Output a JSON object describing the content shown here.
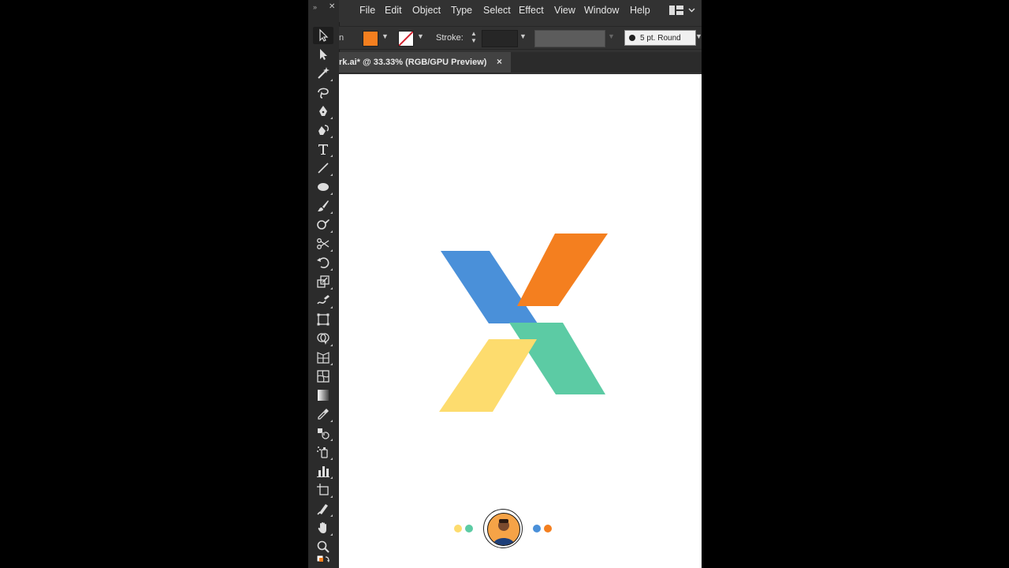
{
  "menu": {
    "items": [
      "File",
      "Edit",
      "Object",
      "Type",
      "Select",
      "Effect",
      "View",
      "Window",
      "Help"
    ]
  },
  "control_bar": {
    "leading_text": "n",
    "fill_color": "#f47f1f",
    "stroke_label": "Stroke:",
    "stroke_value": "",
    "brush_label": "5 pt. Round"
  },
  "document": {
    "tab_title": "rk.ai* @ 33.33% (RGB/GPU Preview)",
    "close_glyph": "×"
  },
  "tools": [
    "selection-tool-icon",
    "direct-selection-tool-icon",
    "magic-wand-tool-icon",
    "lasso-tool-icon",
    "pen-tool-icon",
    "curvature-tool-icon",
    "type-tool-icon",
    "line-segment-tool-icon",
    "ellipse-tool-icon",
    "paintbrush-tool-icon",
    "shaper-tool-icon",
    "scissors-tool-icon",
    "rotate-tool-icon",
    "scale-tool-icon",
    "warp-tool-icon",
    "free-transform-tool-icon",
    "shape-builder-tool-icon",
    "perspective-grid-tool-icon",
    "mesh-tool-icon",
    "gradient-tool-icon",
    "eyedropper-tool-icon",
    "blend-tool-icon",
    "symbol-sprayer-tool-icon",
    "column-graph-tool-icon",
    "artboard-tool-icon",
    "slice-tool-icon",
    "hand-tool-icon",
    "zoom-tool-icon"
  ],
  "artwork": {
    "colors": {
      "blue": "#4a90d9",
      "orange": "#f47f1f",
      "green": "#5ccba4",
      "yellow": "#fddc6e"
    }
  },
  "brand_dots": [
    "#fddc6e",
    "#5ccba4",
    "#4a90d9",
    "#f47f1f"
  ]
}
